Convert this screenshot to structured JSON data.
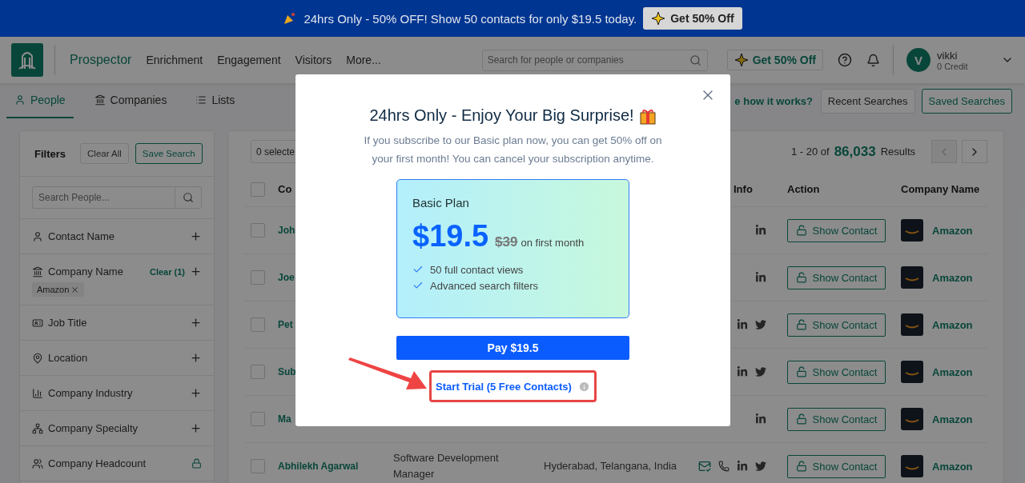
{
  "banner": {
    "text": "24hrs Only - 50% OFF! Show 50 contacts for only $19.5 today.",
    "button": "Get 50% Off"
  },
  "header": {
    "nav": [
      {
        "label": "Prospector",
        "selected": true
      },
      {
        "label": "Enrichment",
        "selected": false
      },
      {
        "label": "Engagement",
        "selected": false
      },
      {
        "label": "Visitors",
        "selected": false
      },
      {
        "label": "More...",
        "selected": false
      }
    ],
    "search": {
      "placeholder": "Search for people or companies"
    },
    "promo_button": "Get 50% Off",
    "user": {
      "initial": "V",
      "name": "vikki",
      "credit": "0 Credit"
    }
  },
  "tabs": [
    {
      "label": "People",
      "kind": "person",
      "selected": true
    },
    {
      "label": "Companies",
      "kind": "bank",
      "selected": false
    },
    {
      "label": "Lists",
      "kind": "list",
      "selected": false
    }
  ],
  "toolbar": {
    "help_link": "e how it works?",
    "buttons": [
      {
        "label": "Recent Searches",
        "selected": false
      },
      {
        "label": "Saved Searches",
        "selected": true
      }
    ]
  },
  "filters": {
    "title": "Filters",
    "clear_all": "Clear All",
    "save_search": "Save Search",
    "search": {
      "placeholder": "Search People..."
    },
    "items": [
      {
        "label": "Contact Name",
        "kind": "person",
        "locked": false
      },
      {
        "label": "Company Name",
        "kind": "bank",
        "locked": false,
        "clear": "Clear (1)",
        "tags": [
          "Amazon"
        ]
      },
      {
        "label": "Job Title",
        "kind": "idcard",
        "locked": false
      },
      {
        "label": "Location",
        "kind": "pin",
        "locked": false
      },
      {
        "label": "Company Industry",
        "kind": "chart",
        "locked": false
      },
      {
        "label": "Company Specialty",
        "kind": "tree",
        "locked": false
      },
      {
        "label": "Company Headcount",
        "kind": "people",
        "locked": true
      }
    ]
  },
  "results": {
    "selected": "0 selecte",
    "range": "1 - 20 of",
    "total": "86,033",
    "suffix": "Results",
    "select_all": {
      "checked": false
    },
    "columns": [
      {
        "label": "Co"
      },
      {
        "label": "Info"
      },
      {
        "label": "Action"
      },
      {
        "label": "Company Name"
      }
    ],
    "rows": [
      {
        "checked": false,
        "name": "Joh",
        "info": [
          {
            "kind": "linkedin"
          }
        ],
        "action": "Show Contact",
        "company": "Amazon"
      },
      {
        "checked": false,
        "name": "Joe",
        "info": [
          {
            "kind": "linkedin"
          }
        ],
        "action": "Show Contact",
        "company": "Amazon"
      },
      {
        "checked": false,
        "name": "Pet",
        "info": [
          {
            "kind": "linkedin"
          },
          {
            "kind": "twitter"
          }
        ],
        "action": "Show Contact",
        "company": "Amazon"
      },
      {
        "checked": false,
        "name": "Sub",
        "info": [
          {
            "kind": "linkedin"
          },
          {
            "kind": "twitter"
          }
        ],
        "action": "Show Contact",
        "company": "Amazon"
      },
      {
        "checked": false,
        "name": "Ma",
        "info": [
          {
            "kind": "linkedin"
          }
        ],
        "action": "Show Contact",
        "company": "Amazon"
      },
      {
        "checked": false,
        "name": "Abhilekh Agarwal",
        "title": "Software Development Manager",
        "location": "Hyderabad, Telangana, India",
        "info": [
          {
            "kind": "email"
          },
          {
            "kind": "phone"
          },
          {
            "kind": "linkedin"
          },
          {
            "kind": "twitter"
          }
        ],
        "action": "Show Contact",
        "company": "Amazon"
      }
    ]
  },
  "modal": {
    "title": "24hrs Only - Enjoy Your Big Surprise!",
    "description": "If you subscribe to our Basic plan now, you can get 50% off on your first month! You can cancel your subscription anytime.",
    "plan": {
      "name": "Basic Plan",
      "price": "$19.5",
      "old_price": "$39",
      "period": "on first month",
      "features": [
        "50 full contact views",
        "Advanced search filters"
      ]
    },
    "pay_button": "Pay $19.5",
    "trial_link": "Start Trial (5 Free Contacts)"
  }
}
